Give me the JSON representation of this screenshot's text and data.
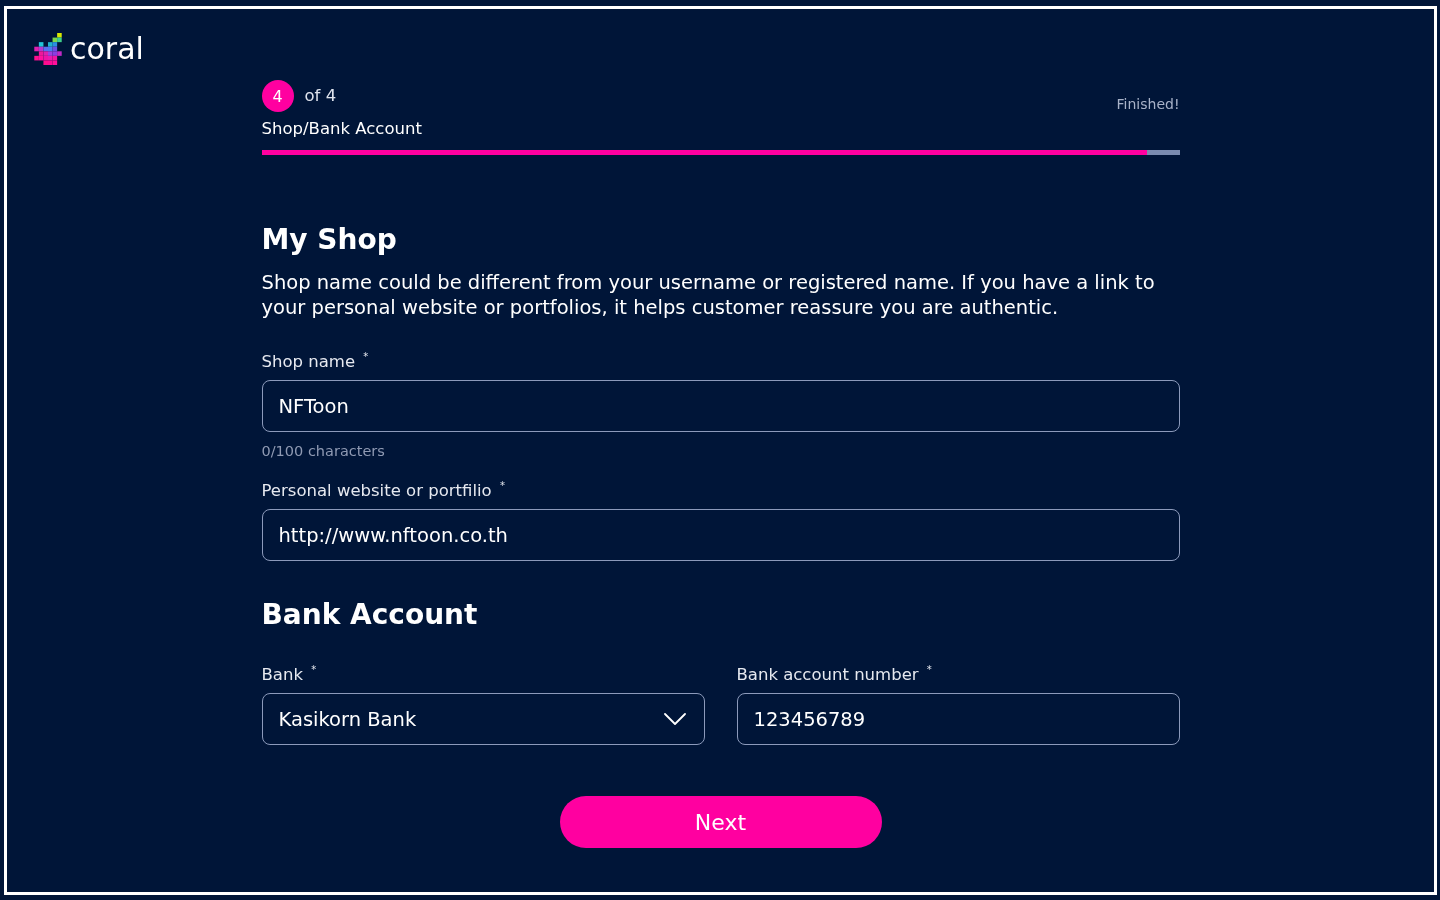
{
  "logo": {
    "text": "coral"
  },
  "progress": {
    "step": "4",
    "of": "of 4",
    "title": "Shop/Bank Account",
    "end_label": "Finished!",
    "level": 0.965
  },
  "sections": [
    {
      "heading": "My Shop",
      "description": "Shop name could be different from your username or registered name. If you have a link to your personal website or portfolios, it helps customer reassure you are authentic.",
      "field_rows": [
        [
          {
            "kind": "text",
            "label": "Shop name $^{*}$",
            "value": "NFToon",
            "helper": "0/100 characters"
          }
        ],
        [
          {
            "kind": "text",
            "label": "Personal website or portfilio $^{*}$",
            "value": "http://www.nftoon.co.th"
          }
        ]
      ]
    },
    {
      "heading": "Bank Account",
      "field_rows": [
        [
          {
            "kind": "select",
            "label": "Bank $^{*}$",
            "value": "Kasikorn Bank"
          },
          {
            "kind": "text",
            "label": "Bank account number $^{*}$",
            "value": "123456789"
          }
        ]
      ]
    }
  ],
  "next_button": "Next"
}
